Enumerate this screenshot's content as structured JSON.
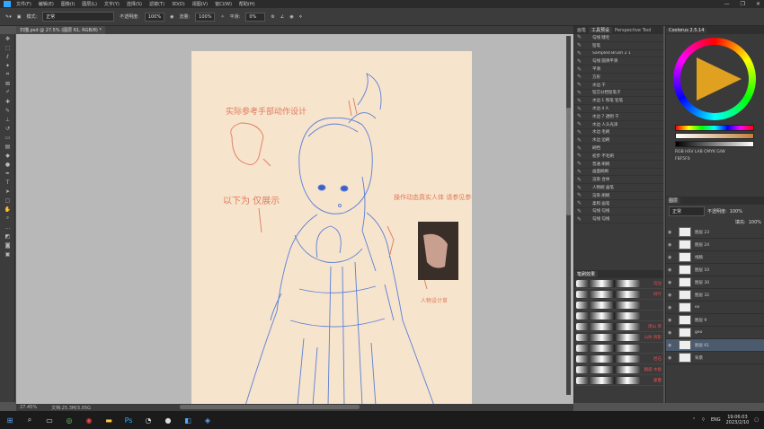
{
  "menu": [
    "文件(F)",
    "编辑(E)",
    "图像(I)",
    "图层(L)",
    "文字(Y)",
    "选择(S)",
    "滤镜(T)",
    "3D(D)",
    "视图(V)",
    "窗口(W)",
    "帮助(H)"
  ],
  "options": {
    "mode_label": "模式:",
    "mode_value": "正常",
    "opacity_label": "不透明度:",
    "opacity_value": "100%",
    "flow_label": "流量:",
    "flow_value": "100%",
    "smooth_label": "平滑:",
    "smooth_value": "0%"
  },
  "doc_tab": "扫描.psd @ 27.5% (图层 61, RGB/8) *",
  "status": {
    "zoom": "27.45%",
    "doc": "文档:25.3M/3.05G"
  },
  "brush_panel": {
    "tabs": [
      "画笔",
      "工具预设",
      "Perspective Tool"
    ],
    "items": [
      "勾线 睫毛",
      "铅笔",
      "Sampled Brush 2 1",
      "勾线 圆滑平滑",
      "平滑",
      "方形",
      "水边 干",
      "铅芯分档铅笔子",
      "水边 1 和笔 铅笔",
      "水边 4 A",
      "水边 7 透明 干",
      "水边 人头光泽",
      "水边 毛刷",
      "水边 边刷",
      "刷档",
      "初步 不毛刷",
      "普通 刷刷",
      "画面刷刷",
      "渲染 合体",
      "人物刷 画笔",
      "渲染 刷刷",
      "柔和 画笔",
      "勾线 勾线",
      "勾线 勾线"
    ]
  },
  "brush_panel2": {
    "title": "笔刷效果",
    "labels": [
      "勾边",
      "树叶",
      "",
      "",
      "南山 草",
      "山体 阴影",
      "",
      "岩石",
      "翻越 木板",
      "藤蔓"
    ]
  },
  "color_panel": {
    "title": "Coolorus 2.5.14",
    "mode": "RGB HSV LAB CMYK G/W",
    "hex": "FBF5F0",
    "r": "68",
    "g": "3",
    "b": "97"
  },
  "layers": {
    "title": "图层",
    "mode": "正常",
    "opacity_label": "不透明度:",
    "opacity": "100%",
    "fill_label": "填充:",
    "fill": "100%",
    "items": [
      {
        "name": "图层 23",
        "sel": false
      },
      {
        "name": "图层 24",
        "sel": false
      },
      {
        "name": "线稿",
        "sel": false
      },
      {
        "name": "图层 10",
        "sel": false
      },
      {
        "name": "图层 30",
        "sel": false
      },
      {
        "name": "图层 32",
        "sel": false
      },
      {
        "name": "ex",
        "sel": false
      },
      {
        "name": "图层 9",
        "sel": false
      },
      {
        "name": "geo",
        "sel": false
      },
      {
        "name": "图层 61",
        "sel": true
      },
      {
        "name": "背景",
        "sel": false
      }
    ]
  },
  "canvas_notes": {
    "note1": "实际参考手部动作设计",
    "note2": "以下为 仅展示",
    "note3": "操作动态真实人体 请参见参考图",
    "note4": "人物设计草"
  },
  "taskbar": {
    "time": "19:06:03",
    "date": "2023/2/10",
    "lang": "ENG"
  },
  "colors": {
    "accent": "#31a8ff",
    "sketch": "#5a7fd8",
    "note": "#e07a5a"
  }
}
